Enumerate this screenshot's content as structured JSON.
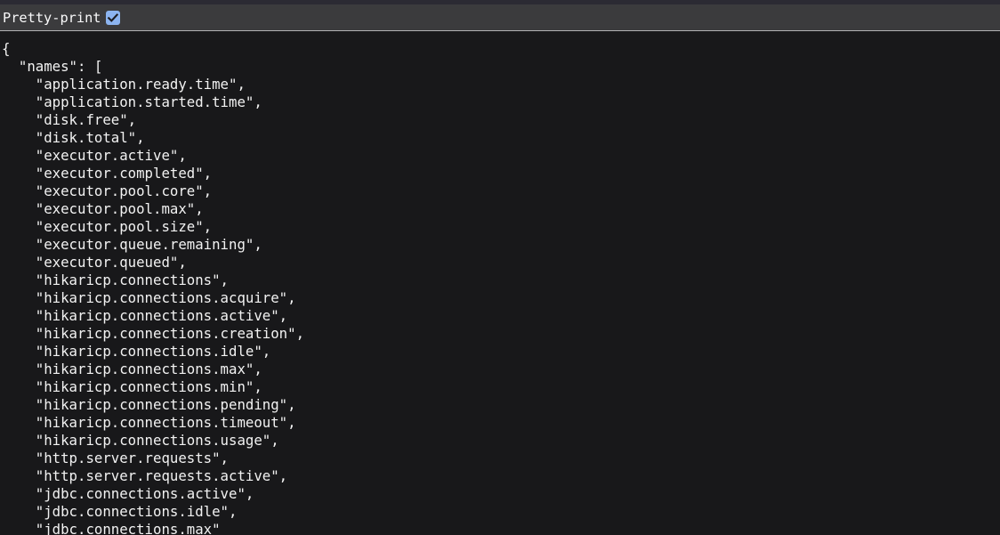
{
  "toolbar": {
    "pretty_print_label": "Pretty-print",
    "pretty_print_checked": true,
    "checkbox_accent": "#8cb4f0",
    "background": "#3b3b3d",
    "text_color": "#f9f9fa"
  },
  "content": {
    "background": "#18181a",
    "text_color": "#f2f2f2",
    "format": "json",
    "root_open": "{",
    "key_label": "\"names\"",
    "array_open": "[",
    "indent_unit": "  ",
    "names": [
      "application.ready.time",
      "application.started.time",
      "disk.free",
      "disk.total",
      "executor.active",
      "executor.completed",
      "executor.pool.core",
      "executor.pool.max",
      "executor.pool.size",
      "executor.queue.remaining",
      "executor.queued",
      "hikaricp.connections",
      "hikaricp.connections.acquire",
      "hikaricp.connections.active",
      "hikaricp.connections.creation",
      "hikaricp.connections.idle",
      "hikaricp.connections.max",
      "hikaricp.connections.min",
      "hikaricp.connections.pending",
      "hikaricp.connections.timeout",
      "hikaricp.connections.usage",
      "http.server.requests",
      "http.server.requests.active",
      "jdbc.connections.active",
      "jdbc.connections.idle",
      "jdbc.connections.max"
    ],
    "raw_text": "{\n  \"names\": [\n    \"application.ready.time\",\n    \"application.started.time\",\n    \"disk.free\",\n    \"disk.total\",\n    \"executor.active\",\n    \"executor.completed\",\n    \"executor.pool.core\",\n    \"executor.pool.max\",\n    \"executor.pool.size\",\n    \"executor.queue.remaining\",\n    \"executor.queued\",\n    \"hikaricp.connections\",\n    \"hikaricp.connections.acquire\",\n    \"hikaricp.connections.active\",\n    \"hikaricp.connections.creation\",\n    \"hikaricp.connections.idle\",\n    \"hikaricp.connections.max\",\n    \"hikaricp.connections.min\",\n    \"hikaricp.connections.pending\",\n    \"hikaricp.connections.timeout\",\n    \"hikaricp.connections.usage\",\n    \"http.server.requests\",\n    \"http.server.requests.active\",\n    \"jdbc.connections.active\",\n    \"jdbc.connections.idle\",\n    \"jdbc.connections.max\""
  }
}
